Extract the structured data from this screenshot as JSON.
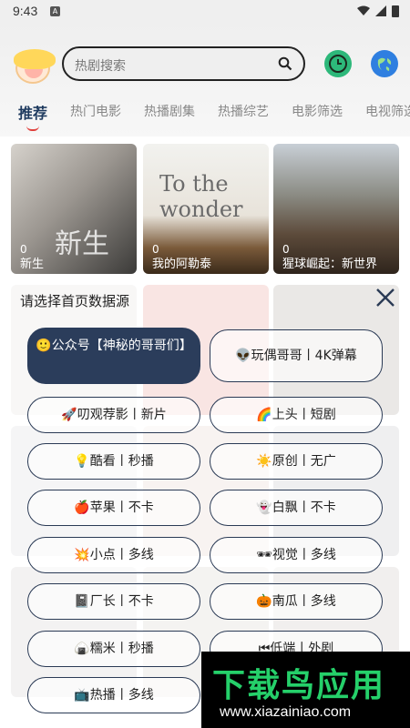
{
  "status_bar": {
    "time": "9:43",
    "notification_icon": "A"
  },
  "header": {
    "search_placeholder": "热剧搜索"
  },
  "tabs": [
    {
      "label": "推荐"
    },
    {
      "label": "热门电影"
    },
    {
      "label": "热播剧集"
    },
    {
      "label": "热播综艺"
    },
    {
      "label": "电影筛选"
    },
    {
      "label": "电视筛选"
    }
  ],
  "posters": [
    {
      "count": "0",
      "title": "新生",
      "deco": "新生"
    },
    {
      "count": "0",
      "title": "我的阿勒泰",
      "deco": "To the wonder"
    },
    {
      "count": "0",
      "title": "猩球崛起：新世界",
      "deco": ""
    }
  ],
  "source_dialog": {
    "title": "请选择首页数据源",
    "options": [
      {
        "label": "🙂公众号【神秘的哥哥们】",
        "selected": true
      },
      {
        "label": "👽玩偶哥哥丨4K弹幕"
      },
      {
        "label": "🚀叨观荐影丨新片"
      },
      {
        "label": "🌈上头丨短剧"
      },
      {
        "label": "💡酷看丨秒播"
      },
      {
        "label": "☀️原创丨无广"
      },
      {
        "label": "🍎苹果丨不卡"
      },
      {
        "label": "👻白飘丨不卡"
      },
      {
        "label": "💥小点丨多线"
      },
      {
        "label": "🕶视觉丨多线"
      },
      {
        "label": "📓厂长丨不卡"
      },
      {
        "label": "🎃南瓜丨多线"
      },
      {
        "label": "🍙糯米丨秒播"
      },
      {
        "label": "⏮低端丨外剧"
      },
      {
        "label": "📺热播丨多线"
      }
    ]
  },
  "watermark": {
    "brand": "下载鸟应用",
    "url": "www.xiazainiao.com"
  },
  "colors": {
    "accent": "#2b3d5b",
    "tab_indicator": "#e0403c",
    "watermark_green": "#25d06a"
  }
}
